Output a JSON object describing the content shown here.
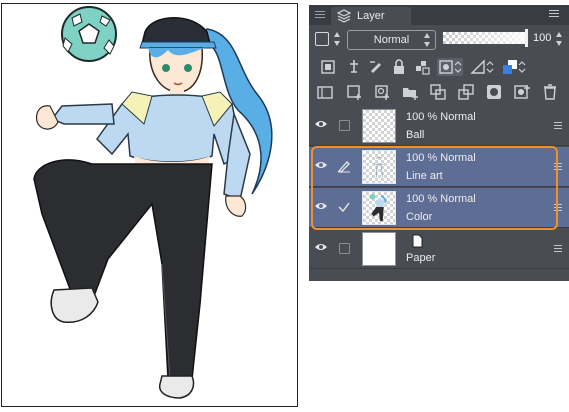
{
  "panel": {
    "tab_label": "Layer",
    "blend_mode": "Normal",
    "opacity_value": "100",
    "opacity_fraction": 1.0
  },
  "layers": [
    {
      "opacity": "100 %",
      "mode": "Normal",
      "name": "Ball",
      "selected": false,
      "status_icon": "none"
    },
    {
      "opacity": "100 %",
      "mode": "Normal",
      "name": "Line art",
      "selected": true,
      "status_icon": "pen-icon"
    },
    {
      "opacity": "100 %",
      "mode": "Normal",
      "name": "Color",
      "selected": true,
      "status_icon": "check-icon"
    },
    {
      "opacity": "",
      "mode": "",
      "name": "Paper",
      "selected": false,
      "status_icon": "none"
    }
  ],
  "colors": {
    "panel_bg": "#4a4c54",
    "selected_row": "#5d6d94",
    "highlight": "#f0902a",
    "hair": "#5aaee6"
  }
}
